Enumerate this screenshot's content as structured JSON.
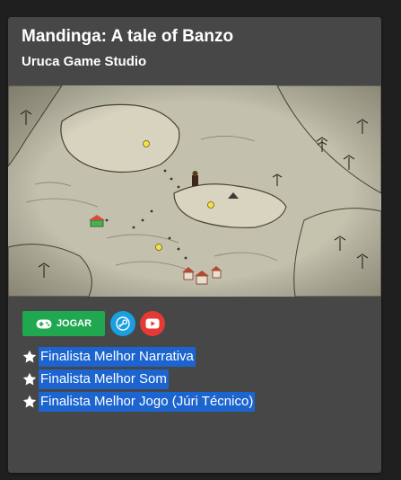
{
  "card": {
    "title": "Mandinga: A tale of Banzo",
    "studio": "Uruca Game Studio"
  },
  "buttons": {
    "play_label": "JOGAR",
    "play_icon": "gamepad-icon",
    "steam_icon": "steam-icon",
    "youtube_icon": "youtube-icon"
  },
  "awards": [
    {
      "label": "Finalista Melhor Narrativa"
    },
    {
      "label": "Finalista Melhor Som"
    },
    {
      "label": "Finalista Melhor Jogo (Júri Técnico)"
    }
  ],
  "colors": {
    "card_background": "#474747",
    "page_background": "#1f1f1f",
    "play_button": "#1fa84f",
    "steam_button": "#1a9fe0",
    "youtube_button": "#e53935",
    "selection_highlight": "#1c64cf"
  }
}
